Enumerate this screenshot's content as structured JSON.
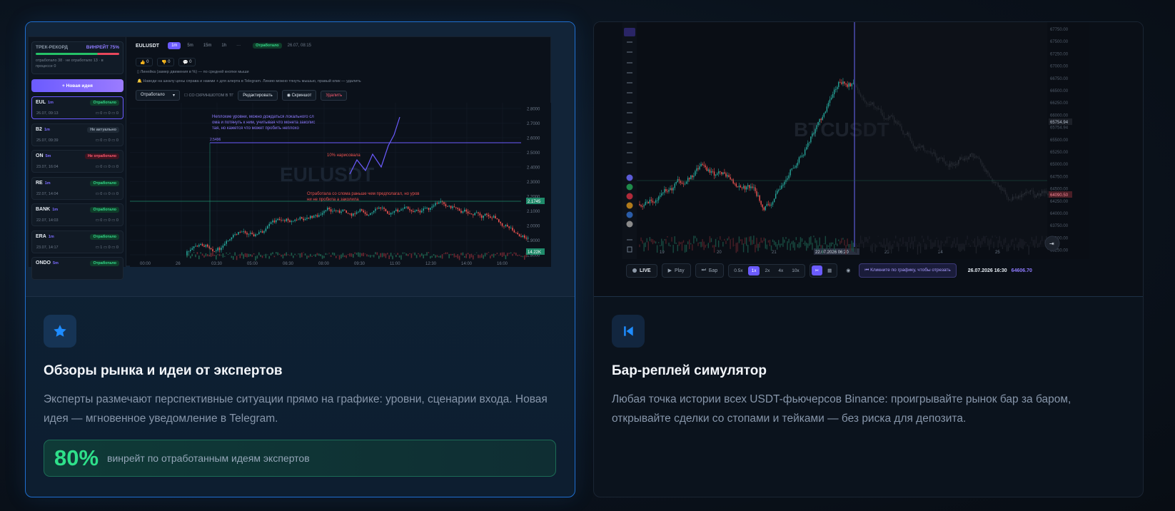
{
  "cards": [
    {
      "icon": "star-icon",
      "title": "Обзоры рынка и идеи от экспертов",
      "description": "Эксперты размечают перспективные ситуации прямо на графике: уровни, сценарии входа. Новая идея — мгновенное уведомление в Telegram.",
      "stat": {
        "value": "80%",
        "label": "винрейт по отработанным идеям экспертов"
      },
      "preview": {
        "track_title": "ТРЕК-РЕКОРД",
        "winrate": "ВИНРЕЙТ 75%",
        "track_text": "отработало 38 · не отработало 13 · в процессе 0",
        "new_idea": "+ Новая идея",
        "ideas": [
          {
            "symbol": "EUL",
            "tf": "1m",
            "status": "Отработало",
            "date": "26.07, 09:13",
            "m": "0 0 0"
          },
          {
            "symbol": "B2",
            "tf": "1m",
            "status": "Не актуально",
            "date": "25.07, 09:39",
            "m": "0 0 0"
          },
          {
            "symbol": "ON",
            "tf": "5m",
            "status": "Не отработало",
            "date": "23.07, 16:04",
            "m": "0 0 0"
          },
          {
            "symbol": "RE",
            "tf": "1m",
            "status": "Отработало",
            "date": "22.07, 14:04",
            "m": "0 0 0"
          },
          {
            "symbol": "BANK",
            "tf": "1m",
            "status": "Отработало",
            "date": "22.07, 14:03",
            "m": "0 0 0"
          },
          {
            "symbol": "ERA",
            "tf": "1m",
            "status": "Отработало",
            "date": "23.07, 14:17",
            "m": "1 0 0"
          },
          {
            "symbol": "ONDO",
            "tf": "5m",
            "status": "Отработало",
            "date": "",
            "m": ""
          }
        ],
        "symbol": "EULUSDT",
        "timeframes": [
          "1m",
          "5m",
          "15m",
          "1h",
          "···"
        ],
        "status_badge": "Отработало",
        "status_date": "26.07, 08:15",
        "counters": [
          "0",
          "0",
          "0"
        ],
        "hint1": "Линейка (замер движения в %) — по средней кнопке мыши",
        "hint2": "Наведи на шкалу цены справа и нажми + для алерта в Telegram. Линию можно тянуть мышью, правый клик — удалить",
        "select_value": "Отработало",
        "checkbox_label": "СО СКРИНШОТОМ В ТГ",
        "btn_edit": "Редактировать",
        "btn_screenshot": "Скриншот",
        "btn_delete": "Удалить",
        "watermark": "EULUSDT",
        "note_top": "Неплохие уровни, можно дождаться локального слома и потянуть к ним, учитывая что монета заколистая, но кажется что может пробить неплохо",
        "note_pct": "10% нарисовала",
        "note_bottom": "Отработала со слома раньше чем предполагал, но уровни не пробила а заколила",
        "price_level": "2.5496",
        "price_current": "2.1745",
        "volume_label": "14.22K",
        "y_ticks": [
          "2.8000",
          "2.7000",
          "2.6000",
          "2.5000",
          "2.4000",
          "2.3000",
          "2.2000",
          "2.1000",
          "2.0000",
          "1.9000",
          "1.8000"
        ],
        "x_ticks": [
          "00:00",
          "26",
          "03:30",
          "05:00",
          "06:30",
          "08:00",
          "09:30",
          "11:00",
          "12:30",
          "14:00",
          "16:00"
        ]
      }
    },
    {
      "icon": "skip-back-icon",
      "title": "Бар-реплей симулятор",
      "description": "Любая точка истории всех USDT-фьючерсов Binance: проигрывайте рынок бар за баром, открывайте сделки со стопами и тейками — без риска для депозита.",
      "preview": {
        "watermark": "BTCUSDT",
        "y_ticks": [
          "67750.00",
          "67500.00",
          "67250.00",
          "67000.00",
          "66750.00",
          "66500.00",
          "66250.00",
          "66000.00",
          "65754.94",
          "65500.00",
          "65250.00",
          "65000.00",
          "64750.00",
          "64500.00",
          "64250.00",
          "64000.00",
          "63750.00",
          "63500.00",
          "63250.00"
        ],
        "x_ticks": [
          "19",
          "20",
          "21",
          "22.07.2026 06:20",
          "23",
          "24",
          "25"
        ],
        "price_tag": "65754.94",
        "price_tag2": "64090.50",
        "live": "LIVE",
        "play": "Play",
        "bar": "Бар",
        "speeds": [
          "0.5x",
          "1x",
          "2x",
          "4x",
          "10x"
        ],
        "cut_hint": "Кликните по графику, чтобы отрезать",
        "timestamp": "26.07.2026 16:30",
        "price": "64606.70"
      }
    }
  ],
  "colors": {
    "accent": "#6b5bff",
    "green": "#2ee08a",
    "blue": "#1e8cff",
    "red": "#e8475c"
  }
}
